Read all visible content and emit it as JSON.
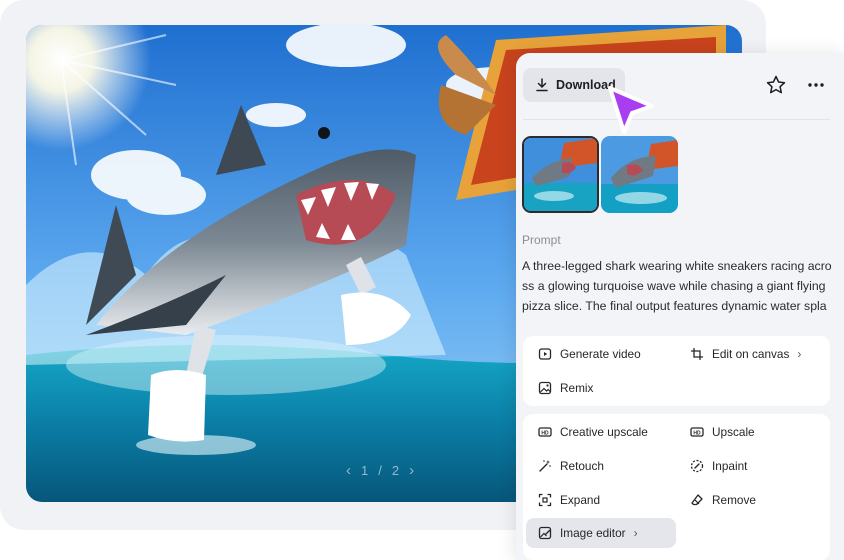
{
  "image": {
    "alt": "A three-legged shark wearing white sneakers racing across a turquoise wave chasing a giant flying pizza slice",
    "pager": {
      "current": "1",
      "separator": "/",
      "total": "2"
    }
  },
  "panel": {
    "download_label": "Download",
    "prompt_label": "Prompt",
    "prompt_text": "A three-legged shark wearing white sneakers racing across a glowing turquoise wave while chasing a giant flying pizza slice. The final output features dynamic water spla",
    "primary_actions": [
      {
        "label": "Generate video",
        "icon": "play-icon"
      },
      {
        "label": "Edit on canvas",
        "icon": "crop-icon",
        "has_submenu": true
      },
      {
        "label": "Remix",
        "icon": "image-remix-icon"
      }
    ],
    "secondary_actions": [
      {
        "label": "Creative upscale",
        "icon": "hd-icon"
      },
      {
        "label": "Upscale",
        "icon": "upscale-icon"
      },
      {
        "label": "Retouch",
        "icon": "magic-wand-icon"
      },
      {
        "label": "Inpaint",
        "icon": "inpaint-icon"
      },
      {
        "label": "Expand",
        "icon": "expand-icon"
      },
      {
        "label": "Remove",
        "icon": "eraser-icon"
      },
      {
        "label": "Image editor",
        "icon": "image-editor-icon",
        "has_submenu": true
      }
    ],
    "submenu_chevron": "›"
  },
  "colors": {
    "cursor": "#a93df0",
    "panel_bg": "#f3f4f7",
    "card_bg": "#ffffff",
    "back_card": "#f1f2f6"
  }
}
